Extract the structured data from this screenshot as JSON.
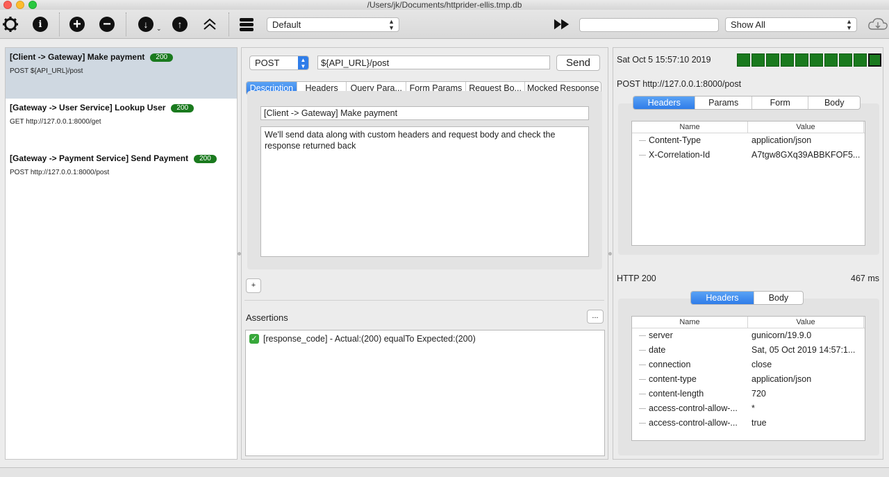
{
  "window": {
    "title": "/Users/jk/Documents/httprider-ellis.tmp.db"
  },
  "toolbar": {
    "environment": "Default",
    "filter_value": "",
    "show_filter": "Show All"
  },
  "requests": [
    {
      "title": "[Client -> Gateway] Make payment",
      "status": "200",
      "url": "POST ${API_URL}/post",
      "selected": true
    },
    {
      "title": "[Gateway -> User Service] Lookup User",
      "status": "200",
      "url": "GET http://127.0.0.1:8000/get",
      "selected": false
    },
    {
      "title": "[Gateway -> Payment Service] Send Payment",
      "status": "200",
      "url": "POST http://127.0.0.1:8000/post",
      "selected": false
    }
  ],
  "editor": {
    "method": "POST",
    "url": "${API_URL}/post",
    "send_label": "Send",
    "tabs": [
      "Description",
      "Headers",
      "Query Para...",
      "Form Params",
      "Request Bo...",
      "Mocked Response"
    ],
    "active_tab": "Description",
    "title_value": "[Client -> Gateway] Make payment",
    "description": "We'll send data along with custom headers and request body and check the response returned back",
    "add_label": "+",
    "assertions_label": "Assertions",
    "more_label": "...",
    "assertion_result": "[response_code]  - Actual:(200) equalTo Expected:(200)"
  },
  "exchange": {
    "timestamp": "Sat Oct  5 15:57:10 2019",
    "request_line": "POST http://127.0.0.1:8000/post",
    "request_tabs": [
      "Headers",
      "Params",
      "Form",
      "Body"
    ],
    "columns": {
      "name": "Name",
      "value": "Value"
    },
    "request_headers": [
      {
        "name": "Content-Type",
        "value": "application/json"
      },
      {
        "name": "X-Correlation-Id",
        "value": "A7tgw8GXq39ABBKFOF5..."
      }
    ],
    "http_status": "HTTP 200",
    "elapsed": "467 ms",
    "response_tabs": [
      "Headers",
      "Body"
    ],
    "response_headers": [
      {
        "name": "server",
        "value": "gunicorn/19.9.0"
      },
      {
        "name": "date",
        "value": "Sat, 05 Oct 2019 14:57:1..."
      },
      {
        "name": "connection",
        "value": "close"
      },
      {
        "name": "content-type",
        "value": "application/json"
      },
      {
        "name": "content-length",
        "value": "720"
      },
      {
        "name": "access-control-allow-...",
        "value": "*"
      },
      {
        "name": "access-control-allow-...",
        "value": "true"
      }
    ]
  },
  "colors": {
    "success": "#1a7a1e",
    "tab_active": "#2f7de9",
    "selection": "#cfd8e1"
  }
}
